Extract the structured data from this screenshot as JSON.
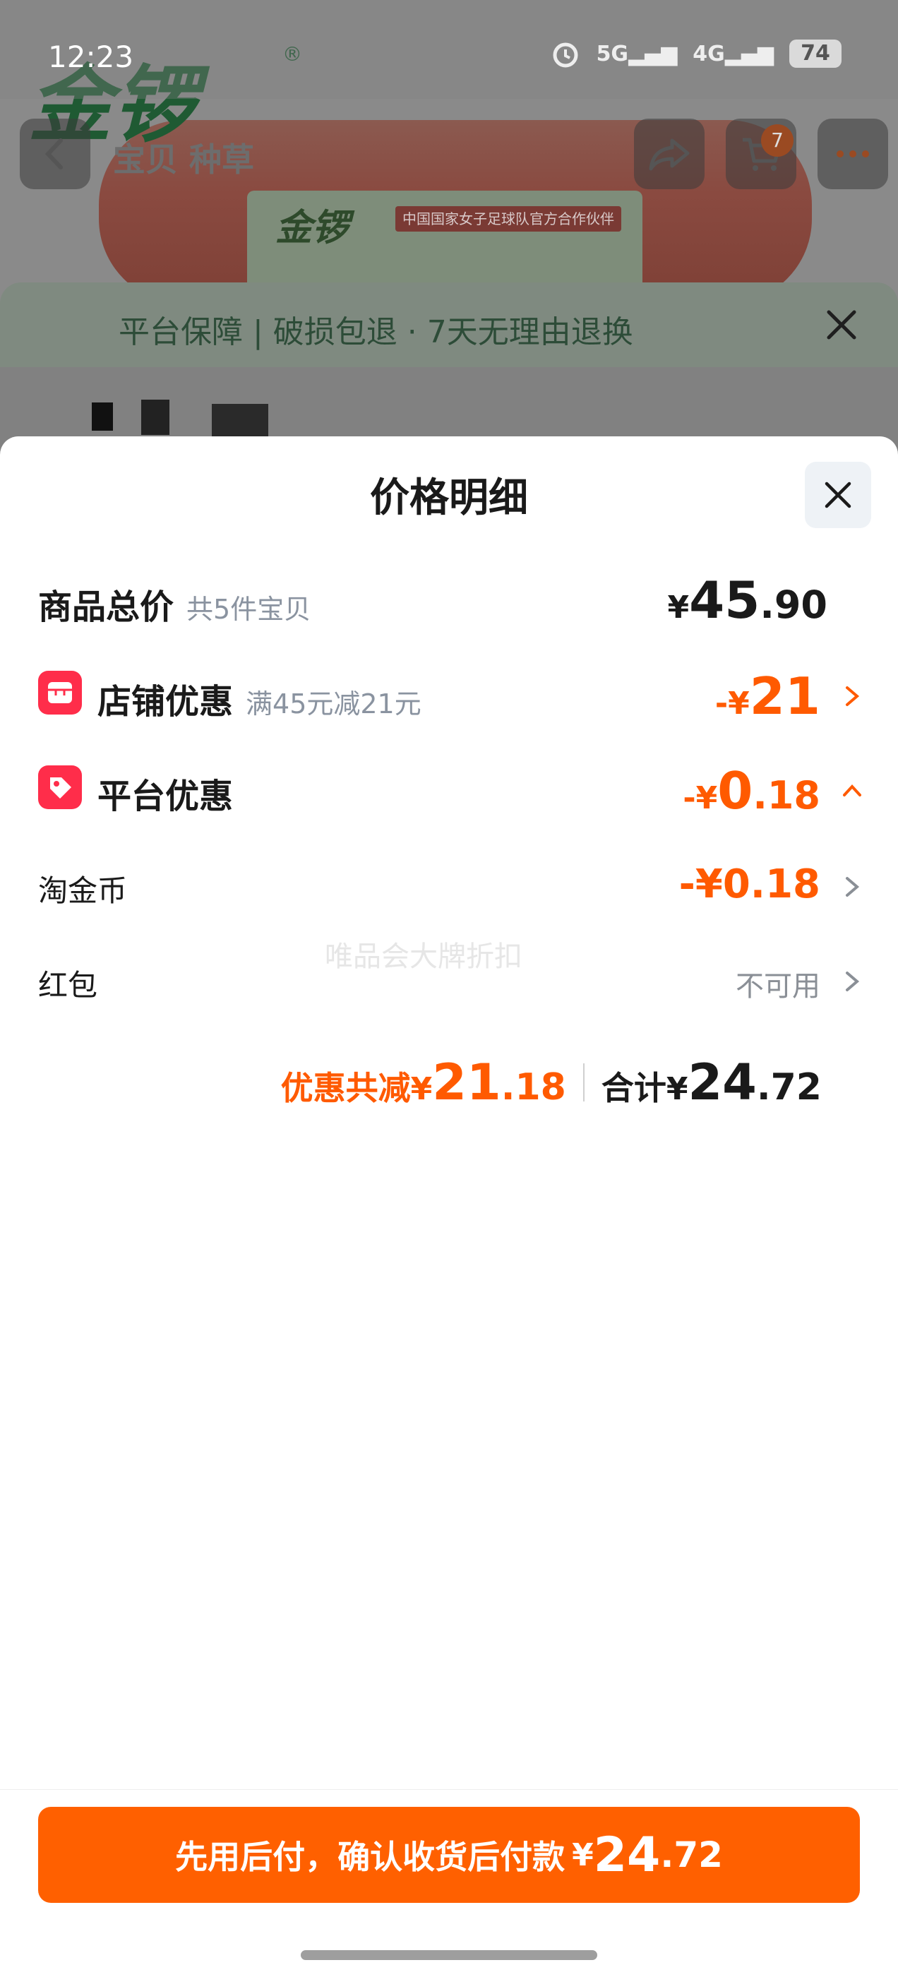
{
  "status_bar": {
    "time": "12:23",
    "battery": "74",
    "net1": "5G",
    "net2": "4G"
  },
  "background_page": {
    "brand": "金锣",
    "brand_mark": "®",
    "title_tabs": "宝贝 种草",
    "cart_badge": "7",
    "product_tag": "中国国家女子足球队官方合作伙伴",
    "guarantee": "平台保障 | 破损包退 · 7天无理由退换"
  },
  "sheet": {
    "title": "价格明细",
    "rows": {
      "total": {
        "label": "商品总价",
        "sub": "共5件宝贝",
        "currency": "¥",
        "int": "45",
        "dec": ".90"
      },
      "store": {
        "label": "店铺优惠",
        "sub": "满45元减21元",
        "prefix": "-¥",
        "int": "21",
        "dec": ""
      },
      "platform": {
        "label": "平台优惠",
        "prefix": "-¥",
        "int": "0",
        "dec": ".18"
      },
      "coins": {
        "label": "淘金币",
        "value": "-¥0.18"
      },
      "redpacket": {
        "label": "红包",
        "value": "不可用"
      }
    },
    "watermark": "唯品会大牌折扣",
    "summary": {
      "discount_label": "优惠共减",
      "discount_cur": "¥",
      "discount_int": "21",
      "discount_dec": ".18",
      "total_label": "合计",
      "total_cur": "¥",
      "total_int": "24",
      "total_dec": ".72"
    }
  },
  "pay_button": {
    "text": "先用后付，确认收货后付款",
    "cur": "¥",
    "int": "24",
    "dec": ".72"
  },
  "colors": {
    "accent": "#ff6000",
    "discount": "#ff5a00",
    "icon_red": "#ff2d4a"
  }
}
